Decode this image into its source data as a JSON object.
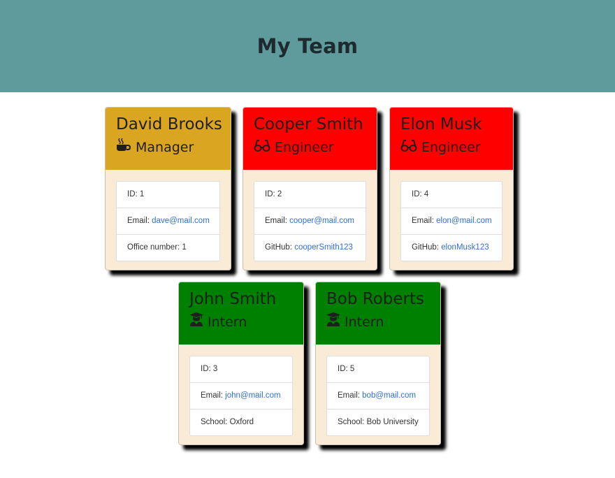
{
  "page": {
    "title": "My Team"
  },
  "colors": {
    "header_bg": "#5f9b9d",
    "manager": "#daa520",
    "engineer": "#ff0000",
    "intern": "#008000",
    "card_body": "#faebd7",
    "link": "#2f6fd6"
  },
  "team": [
    {
      "name": "David Brooks",
      "role": "Manager",
      "icon": "coffee-icon",
      "id_label": "ID:",
      "id": "1",
      "email_label": "Email:",
      "email": "dave@mail.com",
      "extra_label": "Office number:",
      "extra": "1"
    },
    {
      "name": "Cooper Smith",
      "role": "Engineer",
      "icon": "glasses-icon",
      "id_label": "ID:",
      "id": "2",
      "email_label": "Email:",
      "email": "cooper@mail.com",
      "extra_label": "GitHub:",
      "extra": "cooperSmith123"
    },
    {
      "name": "Elon Musk",
      "role": "Engineer",
      "icon": "glasses-icon",
      "id_label": "ID:",
      "id": "4",
      "email_label": "Email:",
      "email": "elon@mail.com",
      "extra_label": "GitHub:",
      "extra": "elonMusk123"
    },
    {
      "name": "John Smith",
      "role": "Intern",
      "icon": "graduate-icon",
      "id_label": "ID:",
      "id": "3",
      "email_label": "Email:",
      "email": "john@mail.com",
      "extra_label": "School:",
      "extra": "Oxford"
    },
    {
      "name": "Bob Roberts",
      "role": "Intern",
      "icon": "graduate-icon",
      "id_label": "ID:",
      "id": "5",
      "email_label": "Email:",
      "email": "bob@mail.com",
      "extra_label": "School:",
      "extra": "Bob University"
    }
  ]
}
